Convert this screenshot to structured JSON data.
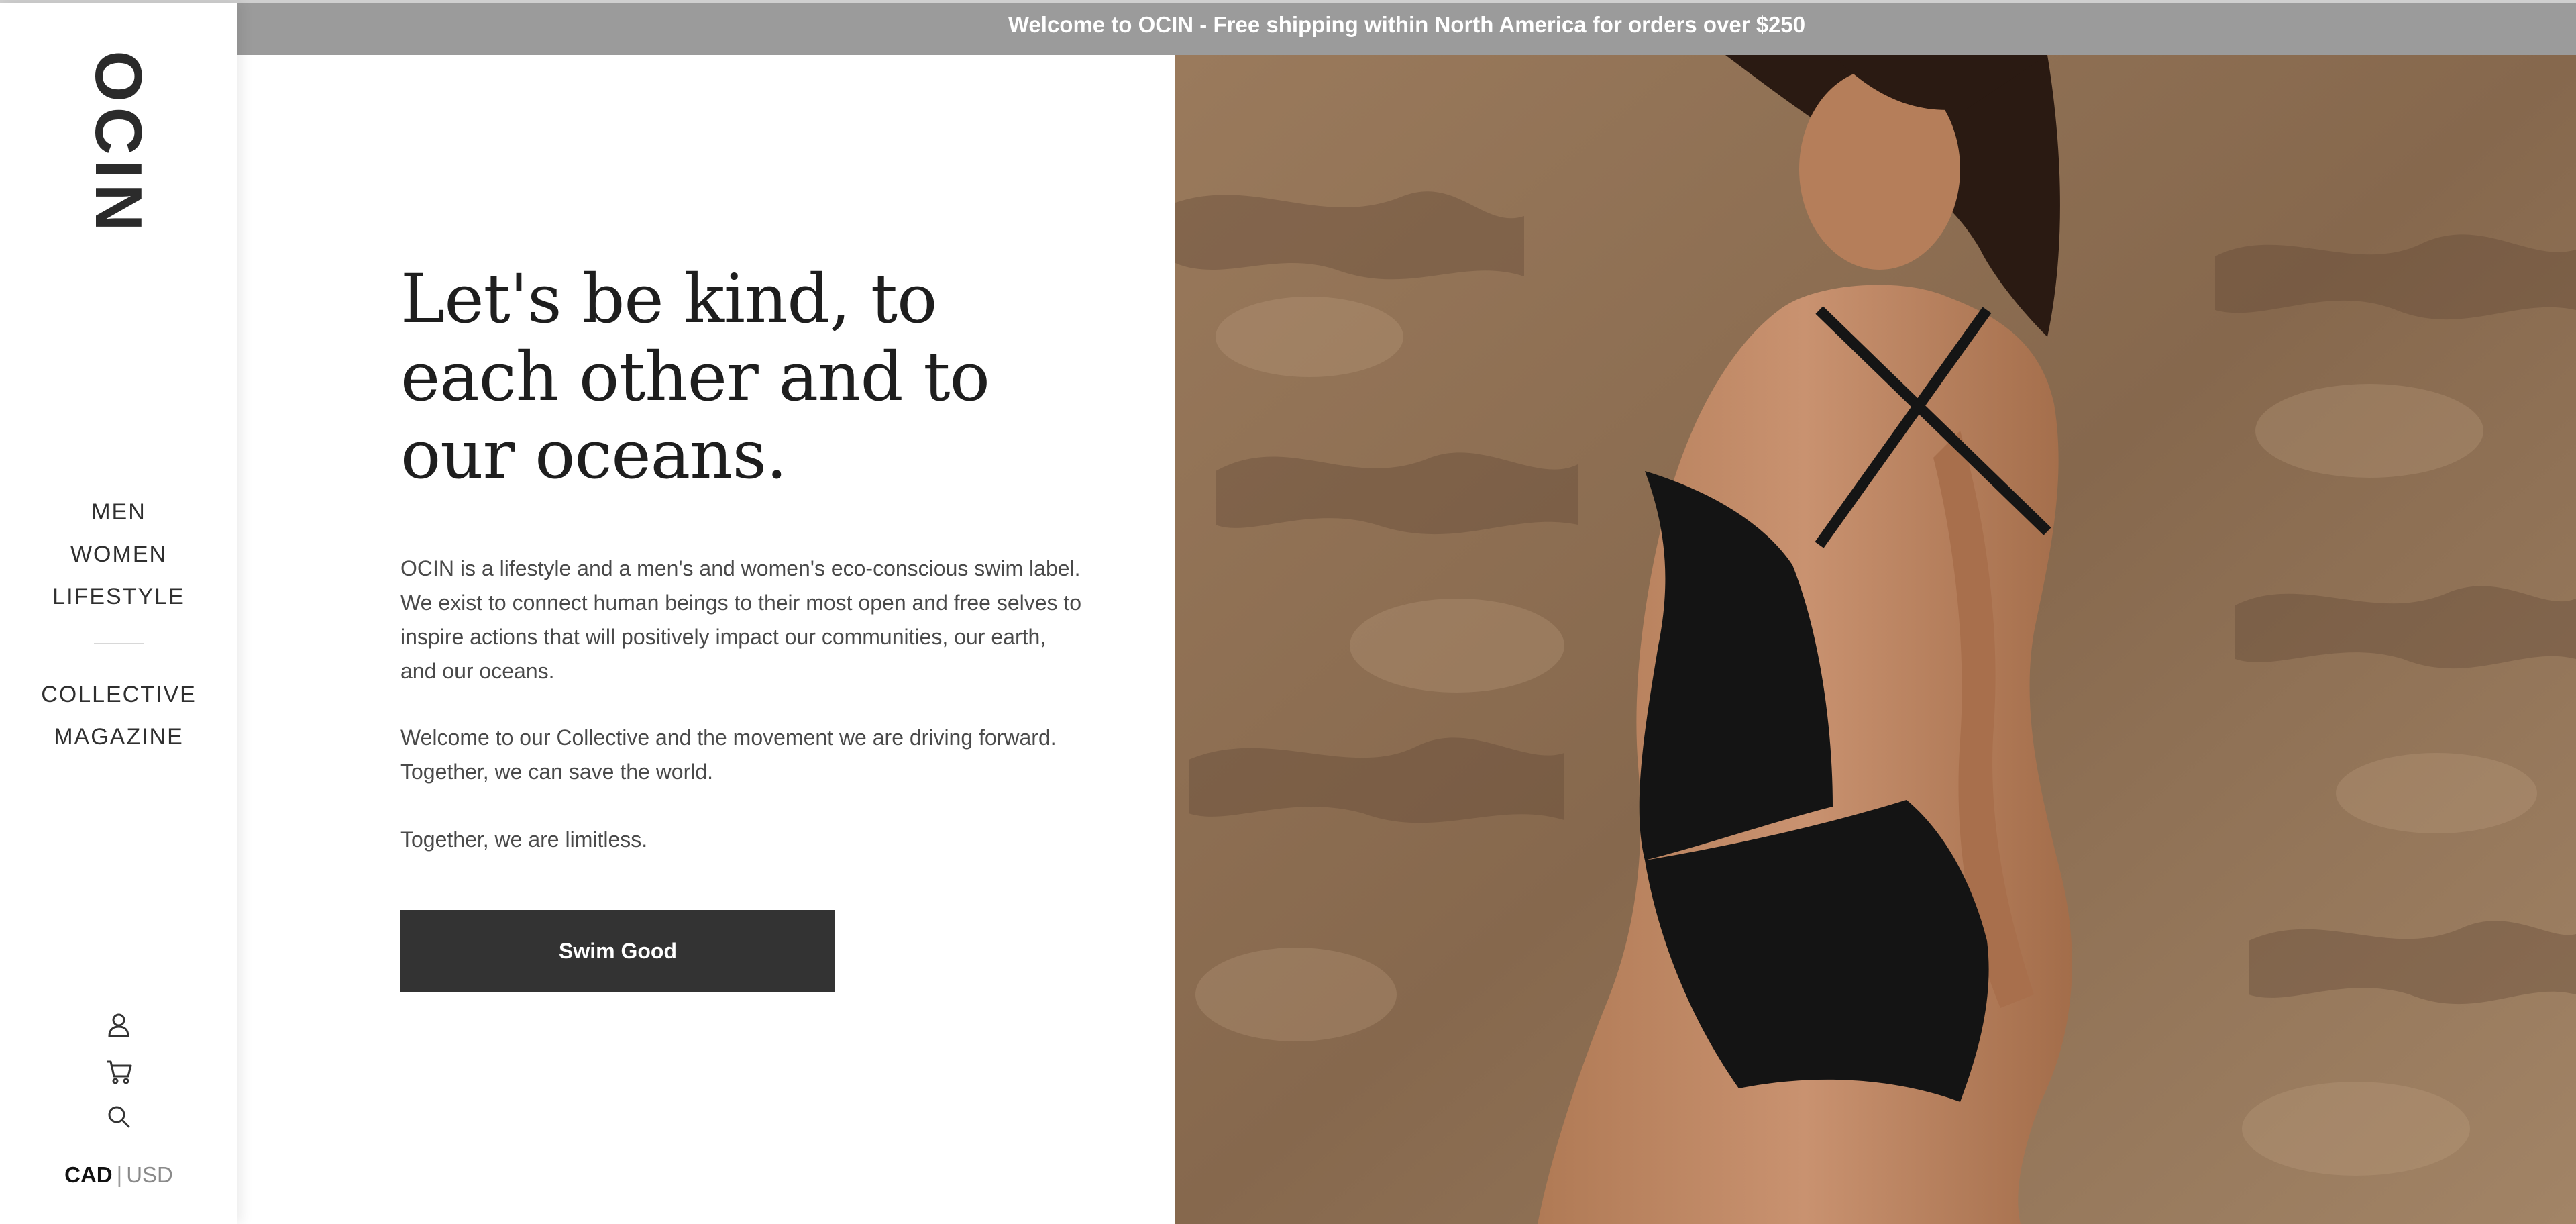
{
  "announcement": "Welcome to OCIN - Free shipping within North America for orders over $250",
  "brand": {
    "logo": "OCIN"
  },
  "sidebar": {
    "nav_primary": [
      {
        "label": "MEN"
      },
      {
        "label": "WOMEN"
      },
      {
        "label": "LIFESTYLE"
      }
    ],
    "nav_secondary": [
      {
        "label": "COLLECTIVE"
      },
      {
        "label": "MAGAZINE"
      }
    ],
    "icons": [
      "account-icon",
      "cart-icon",
      "search-icon"
    ],
    "currency": {
      "active": "CAD",
      "separator": "|",
      "other": "USD"
    }
  },
  "hero": {
    "headline": "Let's be kind, to each other and to our oceans.",
    "paragraphs": [
      "OCIN is a lifestyle and a men's and women's eco-conscious swim label. We exist to connect human beings to their most open and free selves to inspire actions that will positively impact our communities, our earth, and our oceans.",
      "Welcome to our Collective and the movement we are driving forward. Together, we can save the world.",
      "Together, we are limitless."
    ],
    "cta_label": "Swim Good"
  },
  "colors": {
    "announcement_bg": "#9b9b9b",
    "cta_bg": "#333333",
    "text": "#333333"
  }
}
